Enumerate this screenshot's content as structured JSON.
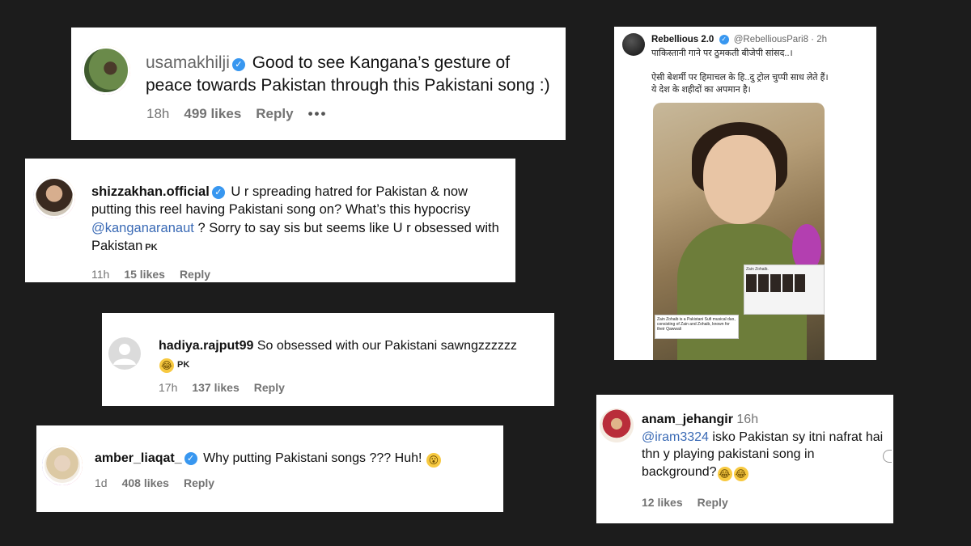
{
  "comments": [
    {
      "username": "usamakhilji",
      "text": "Good to see Kangana’s gesture of peace towards Pakistan through this Pakistani song :)",
      "time": "18h",
      "likes": "499 likes",
      "reply": "Reply",
      "more": "•••"
    },
    {
      "username": "shizzakhan.official",
      "text_a": "U r spreading hatred for Pakistan & now putting this reel having Pakistani song on? What’s this hypocrisy",
      "mention": "@kanganaranaut",
      "text_b": "? Sorry to say sis but seems like U r obsessed with Pakistan",
      "flag": "PK",
      "time": "11h",
      "likes": "15 likes",
      "reply": "Reply"
    },
    {
      "username": "hadiya.rajput99",
      "text": "So obsessed with our Pakistani sawngzzzzzz",
      "flag": "PK",
      "time": "17h",
      "likes": "137 likes",
      "reply": "Reply"
    },
    {
      "username": "amber_liaqat_",
      "text": "Why putting Pakistani songs ??? Huh!",
      "time": "1d",
      "likes": "408 likes",
      "reply": "Reply"
    },
    {
      "username": "anam_jehangir",
      "time_inline": "16h",
      "mention": "@iram3324",
      "text": "isko Pakistan sy itni nafrat hai thn y playing pakistani song in background?",
      "likes": "12 likes",
      "reply": "Reply"
    }
  ],
  "tweet": {
    "name": "Rebellious 2.0",
    "handle": "@RebelliousPari8 · 2h",
    "line1": "पाकिस्तानी गाने पर ठुमकती बीजेपी सांसद..।",
    "line2": "ऐसी बेशर्मी पर हिमाचल के हि..दु ट्रोल चुप्पी साध लेते हैं।",
    "line3": "ये देश के शहीदों का अपमान है।",
    "inset_title": "Zain Zohaib.",
    "inset_desc": "Zain Zohaib is a Pakistani Sufi musical duo, consisting of Zain and Zohaib, known for their Qawwali"
  },
  "colors": {
    "background": "#1c1c1c",
    "mention": "#3a6ab5",
    "verified": "#3897f0",
    "meta": "#737373"
  },
  "icons": [
    "verified-badge-icon",
    "laughing-emoji-icon",
    "surprised-emoji-icon",
    "more-options-icon"
  ]
}
